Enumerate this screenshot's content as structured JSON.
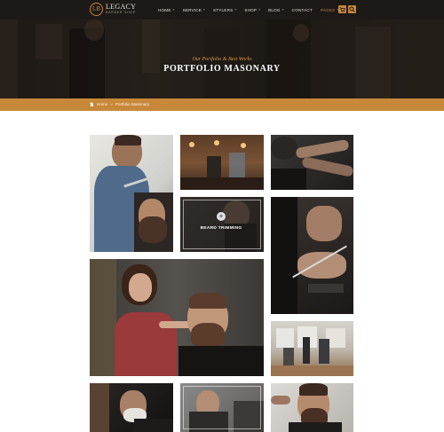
{
  "brand": {
    "mark": "LB",
    "name": "LEGACY",
    "tagline": "BARBER SHOP"
  },
  "nav": {
    "items": [
      {
        "label": "HOME",
        "caret": "▾"
      },
      {
        "label": "SERVICE",
        "caret": "▾"
      },
      {
        "label": "STYLERS",
        "caret": "▾"
      },
      {
        "label": "SHOP",
        "caret": "▾"
      },
      {
        "label": "BLOG",
        "caret": "▾"
      },
      {
        "label": "CONTACT",
        "caret": ""
      },
      {
        "label": "PAGES",
        "caret": "▾"
      }
    ],
    "active": "PAGES",
    "icons": [
      "cart-icon",
      "search-icon"
    ]
  },
  "hero": {
    "subtitle": "Our Portfolio & Best Works",
    "title": "PORTFOLIO MASONARY"
  },
  "breadcrumb": {
    "home": "Home",
    "separator": "»",
    "current": "Portfolio Masonary"
  },
  "gallery": {
    "hover_caption": "BEARD TRIMMING",
    "hover_icon": "plus-icon",
    "photos": [
      "barber-trimming-beard",
      "barbershop-interior",
      "barber-tattooed-arms",
      "beard-trimming-hover",
      "scissors-closeup",
      "female-barber-styling-hair",
      "salon-interior",
      "barber-shaving-client",
      "client-in-chair",
      "bearded-man-haircut"
    ]
  },
  "colors": {
    "accent": "#c8883a",
    "header_bg": "#1c1917",
    "page_bg": "#ffffff"
  }
}
